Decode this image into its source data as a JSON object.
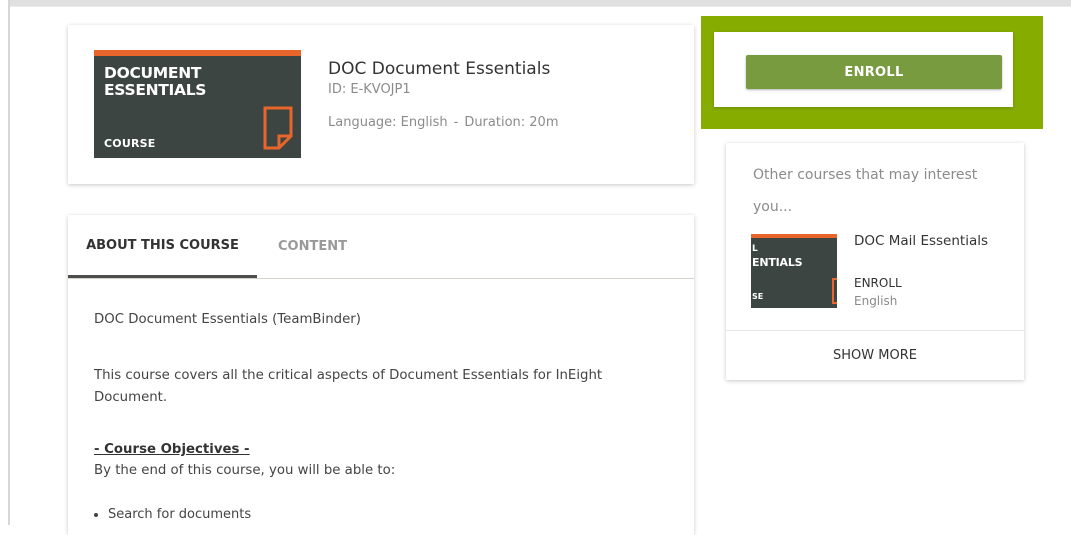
{
  "course": {
    "thumbnail": {
      "line1": "DOCUMENT",
      "line2": "ESSENTIALS",
      "badge": "COURSE"
    },
    "title": "DOC Document Essentials",
    "id": "ID: E-KVOJP1",
    "language": "Language: English",
    "separator": "-",
    "duration": "Duration: 20m"
  },
  "enroll": {
    "label": "ENROLL",
    "highlight_color": "#86ac00",
    "button_color": "#789b3f"
  },
  "tabs": [
    {
      "label": "ABOUT THIS COURSE",
      "active": true
    },
    {
      "label": "CONTENT",
      "active": false
    }
  ],
  "about": {
    "intro": "DOC Document Essentials (TeamBinder)",
    "description": "This course covers all the critical aspects of Document Essentials for InEight Document.",
    "objectives_heading": "- Course Objectives -",
    "objectives_intro": "By the end of this course, you will be able to:",
    "objectives": [
      "Search for documents"
    ]
  },
  "sidebar": {
    "title": "Other courses that may interest you...",
    "recommended": {
      "thumbnail": {
        "line1": "L",
        "line2": "ENTIALS",
        "badge": "SE"
      },
      "title": "DOC Mail Essentials",
      "enroll": "ENROLL",
      "language": "English"
    },
    "show_more": "SHOW MORE"
  },
  "colors": {
    "accent_orange": "#e8662b",
    "thumbnail_bg": "#3d4543"
  }
}
